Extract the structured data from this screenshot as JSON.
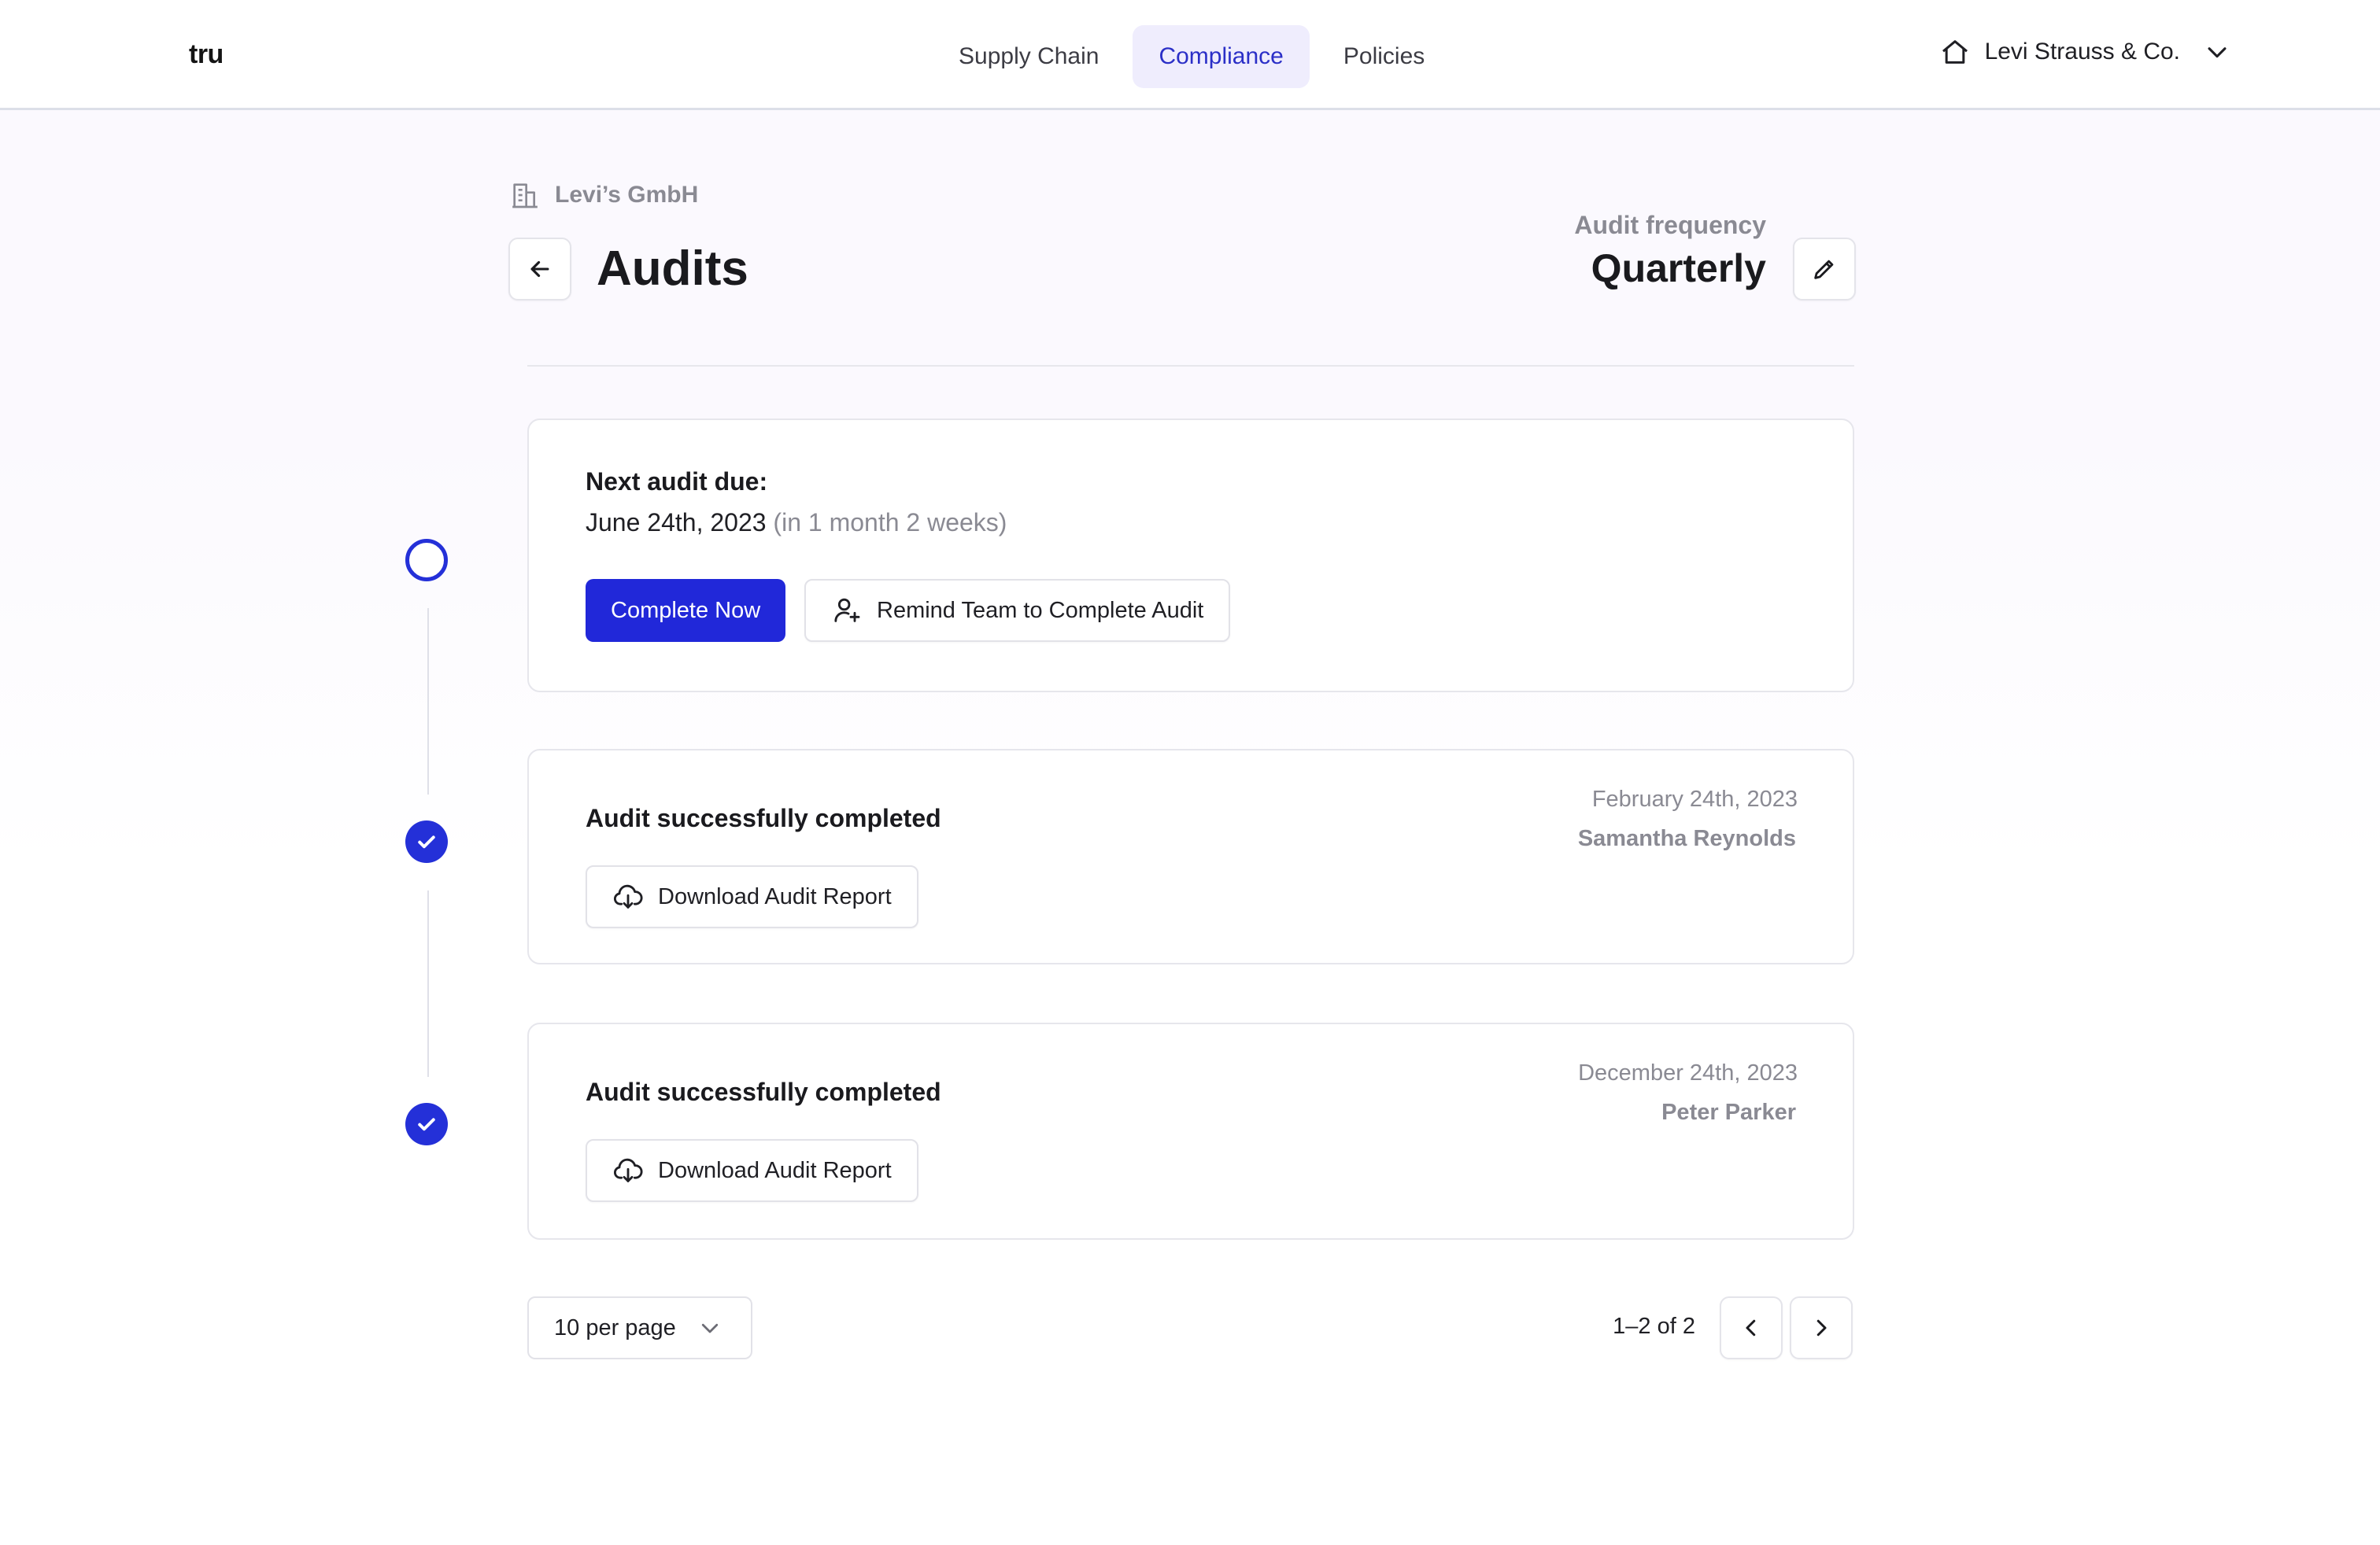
{
  "app": {
    "logo": "tru"
  },
  "nav": {
    "tabs": [
      {
        "label": "Supply Chain",
        "active": false
      },
      {
        "label": "Compliance",
        "active": true
      },
      {
        "label": "Policies",
        "active": false
      }
    ],
    "org_name": "Levi Strauss & Co."
  },
  "header": {
    "breadcrumb": "Levi’s GmbH",
    "title": "Audits",
    "frequency_label": "Audit frequency",
    "frequency_value": "Quarterly"
  },
  "next_audit": {
    "label": "Next audit due:",
    "date": "June 24th, 2023",
    "relative": "(in 1 month 2 weeks)",
    "complete_button": "Complete Now",
    "remind_button": "Remind Team to Complete Audit"
  },
  "completed_audits": [
    {
      "title": "Audit successfully completed",
      "date": "February 24th, 2023",
      "user": "Samantha Reynolds",
      "download_label": "Download Audit Report"
    },
    {
      "title": "Audit successfully completed",
      "date": "December 24th, 2023",
      "user": "Peter Parker",
      "download_label": "Download Audit Report"
    }
  ],
  "pagination": {
    "per_page": "10 per page",
    "range": "1–2 of 2"
  },
  "colors": {
    "accent": "#2128d9",
    "active_tab_bg": "#efedfd",
    "muted_text": "#8a8a93",
    "border": "#e6e6ec"
  },
  "icons": {
    "home": "home-icon",
    "chevron_down": "chevron-down-icon",
    "building": "building-icon",
    "back": "arrow-left-icon",
    "edit": "pencil-icon",
    "user_plus": "user-plus-icon",
    "download": "cloud-download-icon",
    "check": "check-icon",
    "prev": "chevron-left-icon",
    "next": "chevron-right-icon"
  }
}
